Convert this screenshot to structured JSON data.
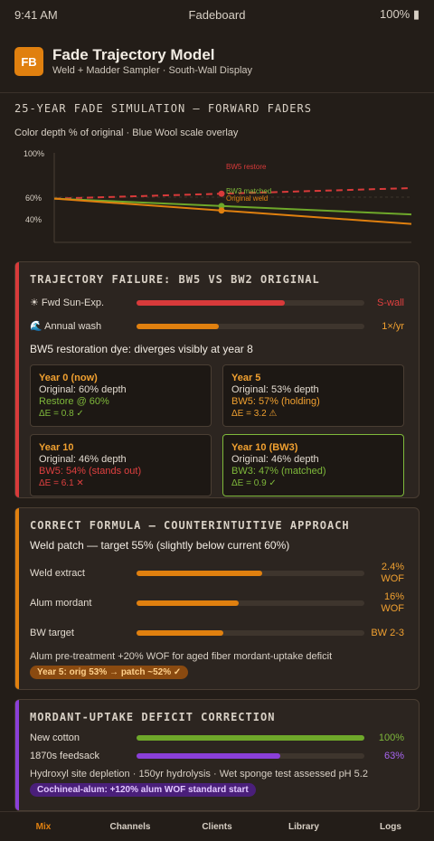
{
  "status": {
    "time": "9:41 AM",
    "carrier": "Fadeboard",
    "battery": "100% ▮"
  },
  "header": {
    "logo": "FB",
    "title": "Fade Trajectory Model",
    "subtitle": "Weld + Madder Sampler · South-Wall Display"
  },
  "sim": {
    "title": "25-YEAR FADE SIMULATION — FORWARD FADERS",
    "subtitle": "Color depth % of original · Blue Wool scale overlay"
  },
  "chart_data": {
    "type": "line",
    "x": [
      0,
      25
    ],
    "yticks": [
      "100%",
      "60%",
      "40%"
    ],
    "series": [
      {
        "name": "BW5 restore",
        "values": [
          60,
          70
        ],
        "color": "#d83a3a",
        "dash": true
      },
      {
        "name": "BW3 matched",
        "values": [
          60,
          45
        ],
        "color": "#6ea82a"
      },
      {
        "name": "Original weld",
        "values": [
          60,
          36
        ],
        "color": "#e0800f"
      }
    ]
  },
  "failure": {
    "title": "TRAJECTORY FAILURE: BW5 VS BW2 ORIGINAL",
    "rows": [
      {
        "label": "☀︎ Fwd Sun-Exp.",
        "value": "S-wall",
        "level": 0.65,
        "color": "#d83a3a"
      },
      {
        "label": "🌊 Annual wash",
        "value": "1×/yr",
        "level": 0.36,
        "color": "#e0800f"
      }
    ],
    "note": "BW5 restoration dye: diverges visibly at year 8",
    "cells": [
      {
        "title": "Year 0 (now)",
        "orig": "Original: 60% depth",
        "line": "Restore @ 60%",
        "line_color": "#7fb93b",
        "de": "ΔE = 0.8 ✓",
        "de_color": "#7fb93b"
      },
      {
        "title": "Year 5",
        "orig": "Original: 53% depth",
        "line": "BW5: 57% (holding)",
        "line_color": "#f0a030",
        "de": "ΔE = 3.2 ⚠",
        "de_color": "#f0a030"
      },
      {
        "title": "Year 10",
        "orig": "Original: 46% depth",
        "line": "BW5: 54% (stands out)",
        "line_color": "#e04040",
        "de": "ΔE = 6.1 ✕",
        "de_color": "#e04040"
      },
      {
        "title": "Year 10 (BW3)",
        "orig": "Original: 46% depth",
        "line": "BW3: 47% (matched)",
        "line_color": "#7fb93b",
        "de": "ΔE = 0.9 ✓",
        "de_color": "#7fb93b"
      }
    ]
  },
  "formula": {
    "title": "CORRECT FORMULA — COUNTERINTUITIVE APPROACH",
    "note": "Weld patch — target 55% (slightly below current 60%)",
    "rows": [
      {
        "label": "Weld extract",
        "value": "2.4% WOF",
        "level": 0.55
      },
      {
        "label": "Alum mordant",
        "value": "16% WOF",
        "level": 0.45
      },
      {
        "label": "BW target",
        "value": "BW 2-3",
        "level": 0.38
      }
    ],
    "foot": "Alum pre-treatment +20% WOF for aged fiber mordant-uptake deficit",
    "pill": "Year 5: orig 53% → patch ~52% ✓"
  },
  "deficit": {
    "title": "MORDANT-UPTAKE DEFICIT CORRECTION",
    "rows": [
      {
        "label": "New cotton",
        "value": "100%",
        "level": 1.0,
        "color": "#6ea82a",
        "vcolor": "#7fb93b"
      },
      {
        "label": "1870s feedsack",
        "value": "63%",
        "level": 0.63,
        "color": "#8a3fd8",
        "vcolor": "#a765f0"
      }
    ],
    "foot": "Hydroxyl site depletion · 150yr hydrolysis · Wet sponge test assessed pH 5.2",
    "pill": "Cochineal-alum: +120% alum WOF standard start"
  },
  "tabs": [
    "Mix",
    "Channels",
    "Clients",
    "Library",
    "Logs"
  ],
  "colors": {
    "accent": "#e0800f",
    "red": "#d83a3a",
    "green": "#6ea82a",
    "purple": "#8a3fd8"
  }
}
